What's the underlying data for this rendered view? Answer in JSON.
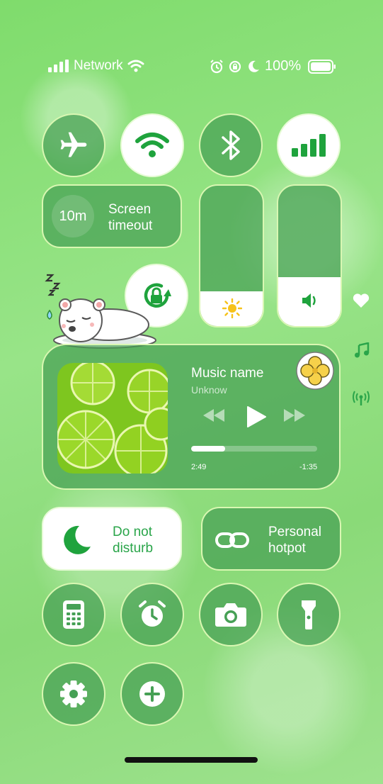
{
  "status_bar": {
    "network_label": "Network",
    "battery_label": "100%"
  },
  "toggles": {
    "airplane": "airplane-icon",
    "wifi": "wifi-icon",
    "bluetooth": "bluetooth-icon",
    "cellular": "cellular-icon",
    "rotation_lock": "rotation-lock-icon"
  },
  "screen_timeout": {
    "value": "10m",
    "label_line1": "Screen",
    "label_line2": "timeout"
  },
  "sliders": {
    "brightness_level": 0.25,
    "volume_level": 0.35
  },
  "music": {
    "title": "Music name",
    "artist": "Unknow",
    "elapsed": "2:49",
    "remaining": "-1:35",
    "progress": 0.27
  },
  "side_icons": [
    "heart-icon",
    "music-note-icon",
    "antenna-icon"
  ],
  "do_not_disturb": {
    "line1": "Do not",
    "line2": "disturb"
  },
  "hotspot": {
    "line1": "Personal",
    "line2": "hotpot"
  },
  "app_buttons": [
    "calculator-icon",
    "alarm-clock-icon",
    "camera-icon",
    "flashlight-icon",
    "settings-icon",
    "add-icon"
  ],
  "colors": {
    "accent": "#1fa33d",
    "glass": "#46a055",
    "border": "#d9f7b2"
  }
}
